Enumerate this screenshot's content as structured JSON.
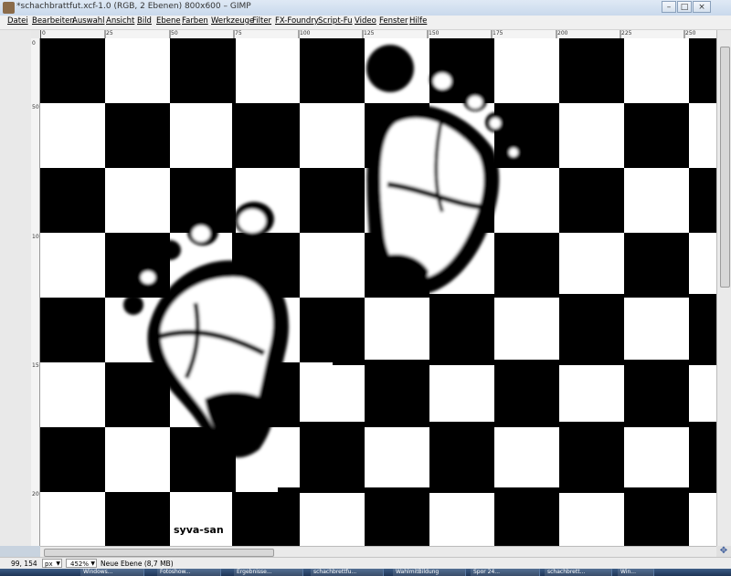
{
  "window": {
    "title": "*schachbrattfut.xcf-1.0 (RGB, 2 Ebenen) 800x600 – GIMP",
    "minimize_icon": "minimize-icon",
    "maximize_icon": "maximize-icon",
    "close_icon": "close-icon",
    "min_glyph": "–",
    "max_glyph": "□",
    "close_glyph": "×"
  },
  "menu": {
    "items": [
      "Datei",
      "Bearbeiten",
      "Auswahl",
      "Ansicht",
      "Bild",
      "Ebene",
      "Farben",
      "Werkzeuge",
      "Filter",
      "FX-Foundry",
      "Script-Fu",
      "Video",
      "Fenster",
      "Hilfe"
    ]
  },
  "ruler_h": {
    "labels": [
      "0",
      "25",
      "50",
      "75",
      "100",
      "125",
      "150",
      "175",
      "200",
      "225",
      "250"
    ]
  },
  "ruler_v": {
    "labels": [
      "0",
      "50",
      "100",
      "150",
      "200"
    ]
  },
  "canvas": {
    "watermark": "syva-san"
  },
  "status": {
    "coords": "99, 154",
    "unit": "px",
    "zoom": "452%",
    "layer_info": "Neue Ebene (8,7 MB)"
  },
  "taskbar": {
    "items": [
      "Windows...",
      "Fotoshow...",
      "Ergebnisse...",
      "schachbrettfu...",
      "WahlmitBildung",
      "Spor 24...",
      "schachbrett...",
      "Win..."
    ]
  },
  "colors": {
    "board_dark": "#000000",
    "board_light": "#ffffff",
    "taskbar": "#1e3556"
  }
}
